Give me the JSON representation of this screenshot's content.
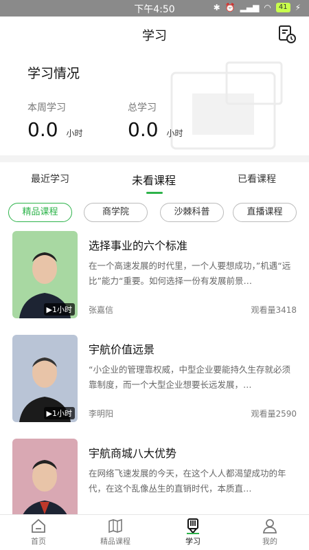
{
  "status_bar": {
    "time": "下午4:50",
    "battery": "41"
  },
  "header": {
    "title": "学习"
  },
  "stats": {
    "title": "学习情况",
    "weekly": {
      "label": "本周学习",
      "value": "0.0",
      "unit": "小时"
    },
    "total": {
      "label": "总学习",
      "value": "0.0",
      "unit": "小时"
    }
  },
  "tabs": [
    {
      "label": "最近学习"
    },
    {
      "label": "未看课程"
    },
    {
      "label": "已看课程"
    }
  ],
  "chips": [
    {
      "label": "精品课程"
    },
    {
      "label": "商学院"
    },
    {
      "label": "沙棘科普"
    },
    {
      "label": "直播课程"
    }
  ],
  "courses": [
    {
      "title": "选择事业的六个标准",
      "desc": "在一个高速发展的时代里，一个人要想成功，”机遇“远比”能力“重要。如何选择一份有发展前景…",
      "author": "张嘉信",
      "views": "观看量3418",
      "duration": "1小时",
      "bg": "#a8d8a2"
    },
    {
      "title": "宇航价值远景",
      "desc": "“小企业的管理靠权威，中型企业要能持久生存就必须靠制度，而一个大型企业想要长远发展，…",
      "author": "李明阳",
      "views": "观看量2590",
      "duration": "1小时",
      "bg": "#b9c4d6"
    },
    {
      "title": "宇航商城八大优势",
      "desc": "在网络飞速发展的今天，在这个人人都渴望成功的年代，在这个乱像丛生的直销时代，本质直…",
      "author": "",
      "views": "",
      "duration": "",
      "bg": "#d9a8b3"
    }
  ],
  "bottom_nav": [
    {
      "label": "首页",
      "icon": "home-icon"
    },
    {
      "label": "精品课程",
      "icon": "book-icon"
    },
    {
      "label": "学习",
      "icon": "study-icon"
    },
    {
      "label": "我的",
      "icon": "user-icon"
    }
  ],
  "colors": {
    "accent": "#2db34a",
    "statusbar": "#8a8a8a"
  }
}
